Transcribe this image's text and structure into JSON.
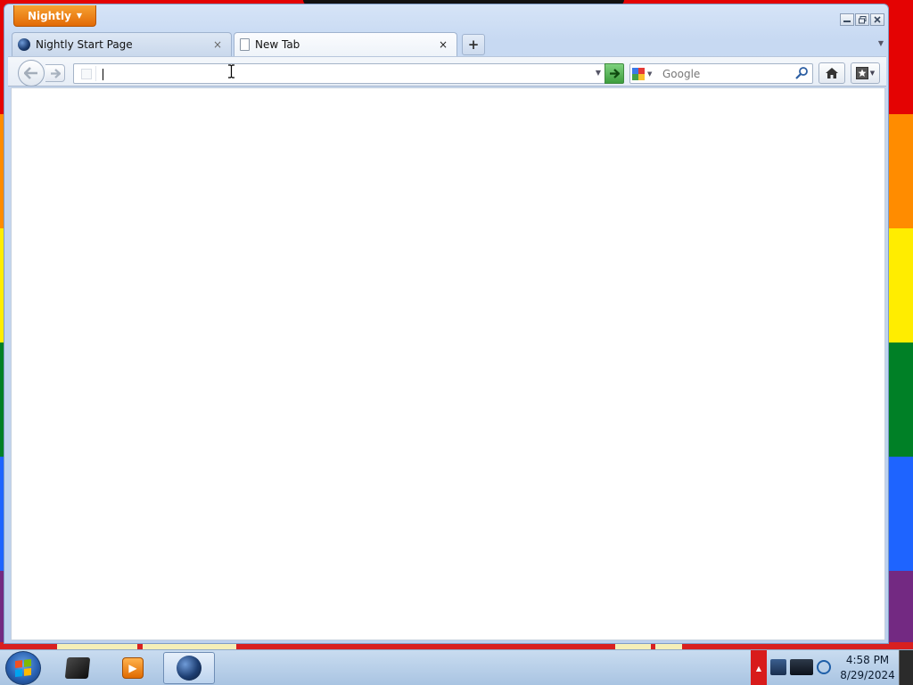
{
  "window": {
    "app_button_label": "Nightly"
  },
  "tabs": [
    {
      "title": "Nightly Start Page",
      "close": "×",
      "active": false
    },
    {
      "title": "New Tab",
      "close": "×",
      "active": true
    }
  ],
  "tabbar": {
    "new_tab_label": "+"
  },
  "navbar": {
    "back": "back-arrow-icon",
    "forward": "forward-arrow-icon",
    "url_value": "",
    "go": "go-arrow-icon",
    "search": {
      "placeholder": "Google",
      "engine": "google-icon"
    }
  },
  "taskbar": {
    "items": [
      {
        "name": "cube-app",
        "active": false
      },
      {
        "name": "media-player",
        "active": false
      },
      {
        "name": "nightly-browser",
        "active": true
      }
    ],
    "clock": {
      "time": "4:58 PM",
      "date": "8/29/2024"
    }
  },
  "colors": {
    "app_button": "#e26a06",
    "go_button": "#3d9d3d",
    "tray_alert": "#d81b1b"
  }
}
